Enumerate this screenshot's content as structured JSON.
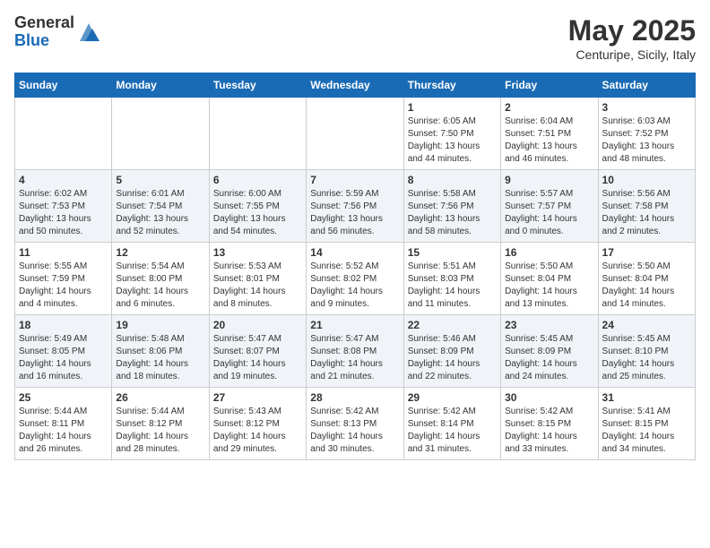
{
  "header": {
    "logo_general": "General",
    "logo_blue": "Blue",
    "title": "May 2025",
    "location": "Centuripe, Sicily, Italy"
  },
  "weekdays": [
    "Sunday",
    "Monday",
    "Tuesday",
    "Wednesday",
    "Thursday",
    "Friday",
    "Saturday"
  ],
  "weeks": [
    [
      {
        "day": "",
        "info": ""
      },
      {
        "day": "",
        "info": ""
      },
      {
        "day": "",
        "info": ""
      },
      {
        "day": "",
        "info": ""
      },
      {
        "day": "1",
        "info": "Sunrise: 6:05 AM\nSunset: 7:50 PM\nDaylight: 13 hours\nand 44 minutes."
      },
      {
        "day": "2",
        "info": "Sunrise: 6:04 AM\nSunset: 7:51 PM\nDaylight: 13 hours\nand 46 minutes."
      },
      {
        "day": "3",
        "info": "Sunrise: 6:03 AM\nSunset: 7:52 PM\nDaylight: 13 hours\nand 48 minutes."
      }
    ],
    [
      {
        "day": "4",
        "info": "Sunrise: 6:02 AM\nSunset: 7:53 PM\nDaylight: 13 hours\nand 50 minutes."
      },
      {
        "day": "5",
        "info": "Sunrise: 6:01 AM\nSunset: 7:54 PM\nDaylight: 13 hours\nand 52 minutes."
      },
      {
        "day": "6",
        "info": "Sunrise: 6:00 AM\nSunset: 7:55 PM\nDaylight: 13 hours\nand 54 minutes."
      },
      {
        "day": "7",
        "info": "Sunrise: 5:59 AM\nSunset: 7:56 PM\nDaylight: 13 hours\nand 56 minutes."
      },
      {
        "day": "8",
        "info": "Sunrise: 5:58 AM\nSunset: 7:56 PM\nDaylight: 13 hours\nand 58 minutes."
      },
      {
        "day": "9",
        "info": "Sunrise: 5:57 AM\nSunset: 7:57 PM\nDaylight: 14 hours\nand 0 minutes."
      },
      {
        "day": "10",
        "info": "Sunrise: 5:56 AM\nSunset: 7:58 PM\nDaylight: 14 hours\nand 2 minutes."
      }
    ],
    [
      {
        "day": "11",
        "info": "Sunrise: 5:55 AM\nSunset: 7:59 PM\nDaylight: 14 hours\nand 4 minutes."
      },
      {
        "day": "12",
        "info": "Sunrise: 5:54 AM\nSunset: 8:00 PM\nDaylight: 14 hours\nand 6 minutes."
      },
      {
        "day": "13",
        "info": "Sunrise: 5:53 AM\nSunset: 8:01 PM\nDaylight: 14 hours\nand 8 minutes."
      },
      {
        "day": "14",
        "info": "Sunrise: 5:52 AM\nSunset: 8:02 PM\nDaylight: 14 hours\nand 9 minutes."
      },
      {
        "day": "15",
        "info": "Sunrise: 5:51 AM\nSunset: 8:03 PM\nDaylight: 14 hours\nand 11 minutes."
      },
      {
        "day": "16",
        "info": "Sunrise: 5:50 AM\nSunset: 8:04 PM\nDaylight: 14 hours\nand 13 minutes."
      },
      {
        "day": "17",
        "info": "Sunrise: 5:50 AM\nSunset: 8:04 PM\nDaylight: 14 hours\nand 14 minutes."
      }
    ],
    [
      {
        "day": "18",
        "info": "Sunrise: 5:49 AM\nSunset: 8:05 PM\nDaylight: 14 hours\nand 16 minutes."
      },
      {
        "day": "19",
        "info": "Sunrise: 5:48 AM\nSunset: 8:06 PM\nDaylight: 14 hours\nand 18 minutes."
      },
      {
        "day": "20",
        "info": "Sunrise: 5:47 AM\nSunset: 8:07 PM\nDaylight: 14 hours\nand 19 minutes."
      },
      {
        "day": "21",
        "info": "Sunrise: 5:47 AM\nSunset: 8:08 PM\nDaylight: 14 hours\nand 21 minutes."
      },
      {
        "day": "22",
        "info": "Sunrise: 5:46 AM\nSunset: 8:09 PM\nDaylight: 14 hours\nand 22 minutes."
      },
      {
        "day": "23",
        "info": "Sunrise: 5:45 AM\nSunset: 8:09 PM\nDaylight: 14 hours\nand 24 minutes."
      },
      {
        "day": "24",
        "info": "Sunrise: 5:45 AM\nSunset: 8:10 PM\nDaylight: 14 hours\nand 25 minutes."
      }
    ],
    [
      {
        "day": "25",
        "info": "Sunrise: 5:44 AM\nSunset: 8:11 PM\nDaylight: 14 hours\nand 26 minutes."
      },
      {
        "day": "26",
        "info": "Sunrise: 5:44 AM\nSunset: 8:12 PM\nDaylight: 14 hours\nand 28 minutes."
      },
      {
        "day": "27",
        "info": "Sunrise: 5:43 AM\nSunset: 8:12 PM\nDaylight: 14 hours\nand 29 minutes."
      },
      {
        "day": "28",
        "info": "Sunrise: 5:42 AM\nSunset: 8:13 PM\nDaylight: 14 hours\nand 30 minutes."
      },
      {
        "day": "29",
        "info": "Sunrise: 5:42 AM\nSunset: 8:14 PM\nDaylight: 14 hours\nand 31 minutes."
      },
      {
        "day": "30",
        "info": "Sunrise: 5:42 AM\nSunset: 8:15 PM\nDaylight: 14 hours\nand 33 minutes."
      },
      {
        "day": "31",
        "info": "Sunrise: 5:41 AM\nSunset: 8:15 PM\nDaylight: 14 hours\nand 34 minutes."
      }
    ]
  ]
}
